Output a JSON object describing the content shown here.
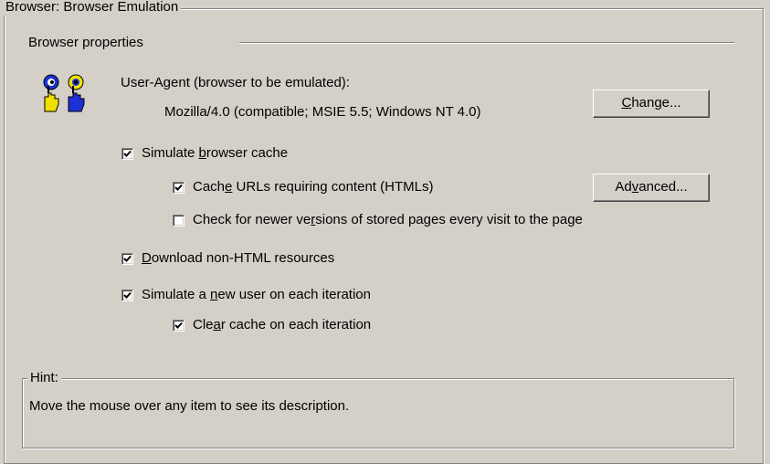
{
  "main_group": {
    "title": "Browser: Browser Emulation"
  },
  "section": {
    "title": "Browser properties"
  },
  "user_agent": {
    "label": "User-Agent (browser to be emulated):",
    "value": "Mozilla/4.0 (compatible; MSIE 5.5; Windows NT 4.0)",
    "change_button": {
      "pre": "",
      "acc": "C",
      "post": "hange..."
    }
  },
  "options": {
    "simulate_cache": {
      "pre": "Simulate ",
      "acc": "b",
      "post": "rowser cache",
      "checked": true
    },
    "cache_urls": {
      "pre": "Cach",
      "acc": "e",
      "post": " URLs requiring content (HTMLs)",
      "checked": true
    },
    "check_newer": {
      "pre": "Check for newer ve",
      "acc": "r",
      "post": "sions of stored pages every visit to the page",
      "checked": false
    },
    "download_non_html": {
      "pre": "",
      "acc": "D",
      "post": "ownload non-HTML resources",
      "checked": true
    },
    "simulate_new_user": {
      "pre": "Simulate a ",
      "acc": "n",
      "post": "ew user on each iteration",
      "checked": true
    },
    "clear_cache": {
      "pre": "Cle",
      "acc": "a",
      "post": "r cache on each iteration",
      "checked": true
    }
  },
  "advanced_button": {
    "pre": "Ad",
    "acc": "v",
    "post": "anced..."
  },
  "hint": {
    "title": "Hint:",
    "text": "Move the mouse over any item to see its description."
  }
}
